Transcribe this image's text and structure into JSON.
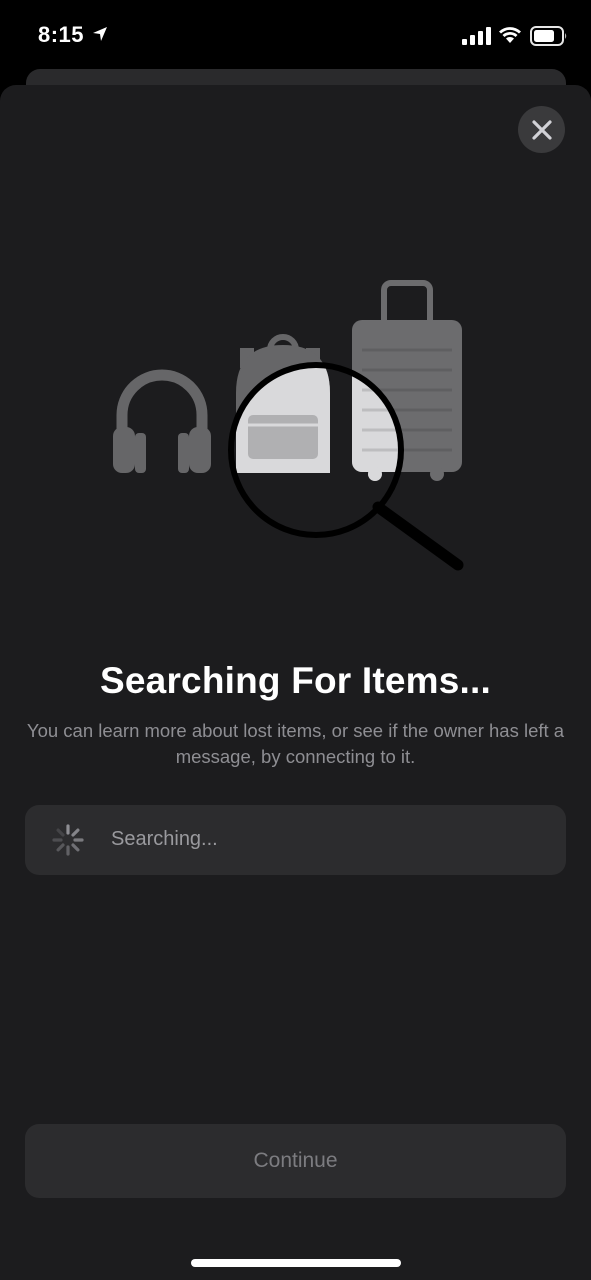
{
  "status_bar": {
    "time": "8:15",
    "icons": [
      "location-arrow-icon",
      "cellular-signal-icon",
      "wifi-icon",
      "battery-icon"
    ]
  },
  "sheet": {
    "close_icon": "close-icon",
    "illustration_icons": [
      "headphones-icon",
      "backpack-icon",
      "suitcase-icon",
      "magnifying-glass-icon"
    ],
    "title": "Searching For Items...",
    "subtitle": "You can learn more about lost items, or see if the owner has left a message, by connecting to it.",
    "status_row": {
      "spinner_icon": "activity-spinner-icon",
      "label": "Searching..."
    },
    "continue_label": "Continue"
  },
  "colors": {
    "background": "#000000",
    "sheet": "#1c1c1e",
    "row": "#2c2c2e",
    "text_primary": "#ffffff",
    "text_secondary": "#8e8e93",
    "disabled_text": "#7c7c80"
  }
}
